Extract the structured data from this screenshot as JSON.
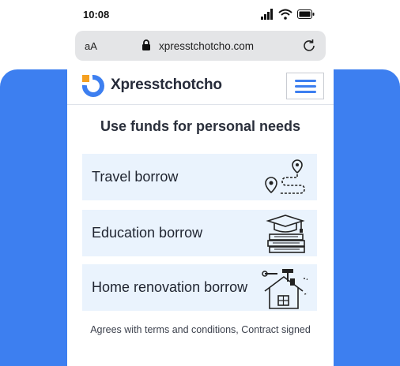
{
  "status": {
    "time": "10:08"
  },
  "browser": {
    "text_size": "aA",
    "url": "xpresstchotcho.com"
  },
  "brand": {
    "name": "Xpresstchotcho",
    "accent": "#3d7ff0",
    "orange": "#f5a020"
  },
  "page": {
    "heading": "Use funds for personal needs"
  },
  "cards": [
    {
      "label": "Travel borrow",
      "icon": "route-map-icon"
    },
    {
      "label": "Education borrow",
      "icon": "graduation-books-icon"
    },
    {
      "label": "Home renovation borrow",
      "icon": "house-tools-icon"
    }
  ],
  "footer": {
    "note": "Agrees with terms and conditions, Contract signed"
  }
}
